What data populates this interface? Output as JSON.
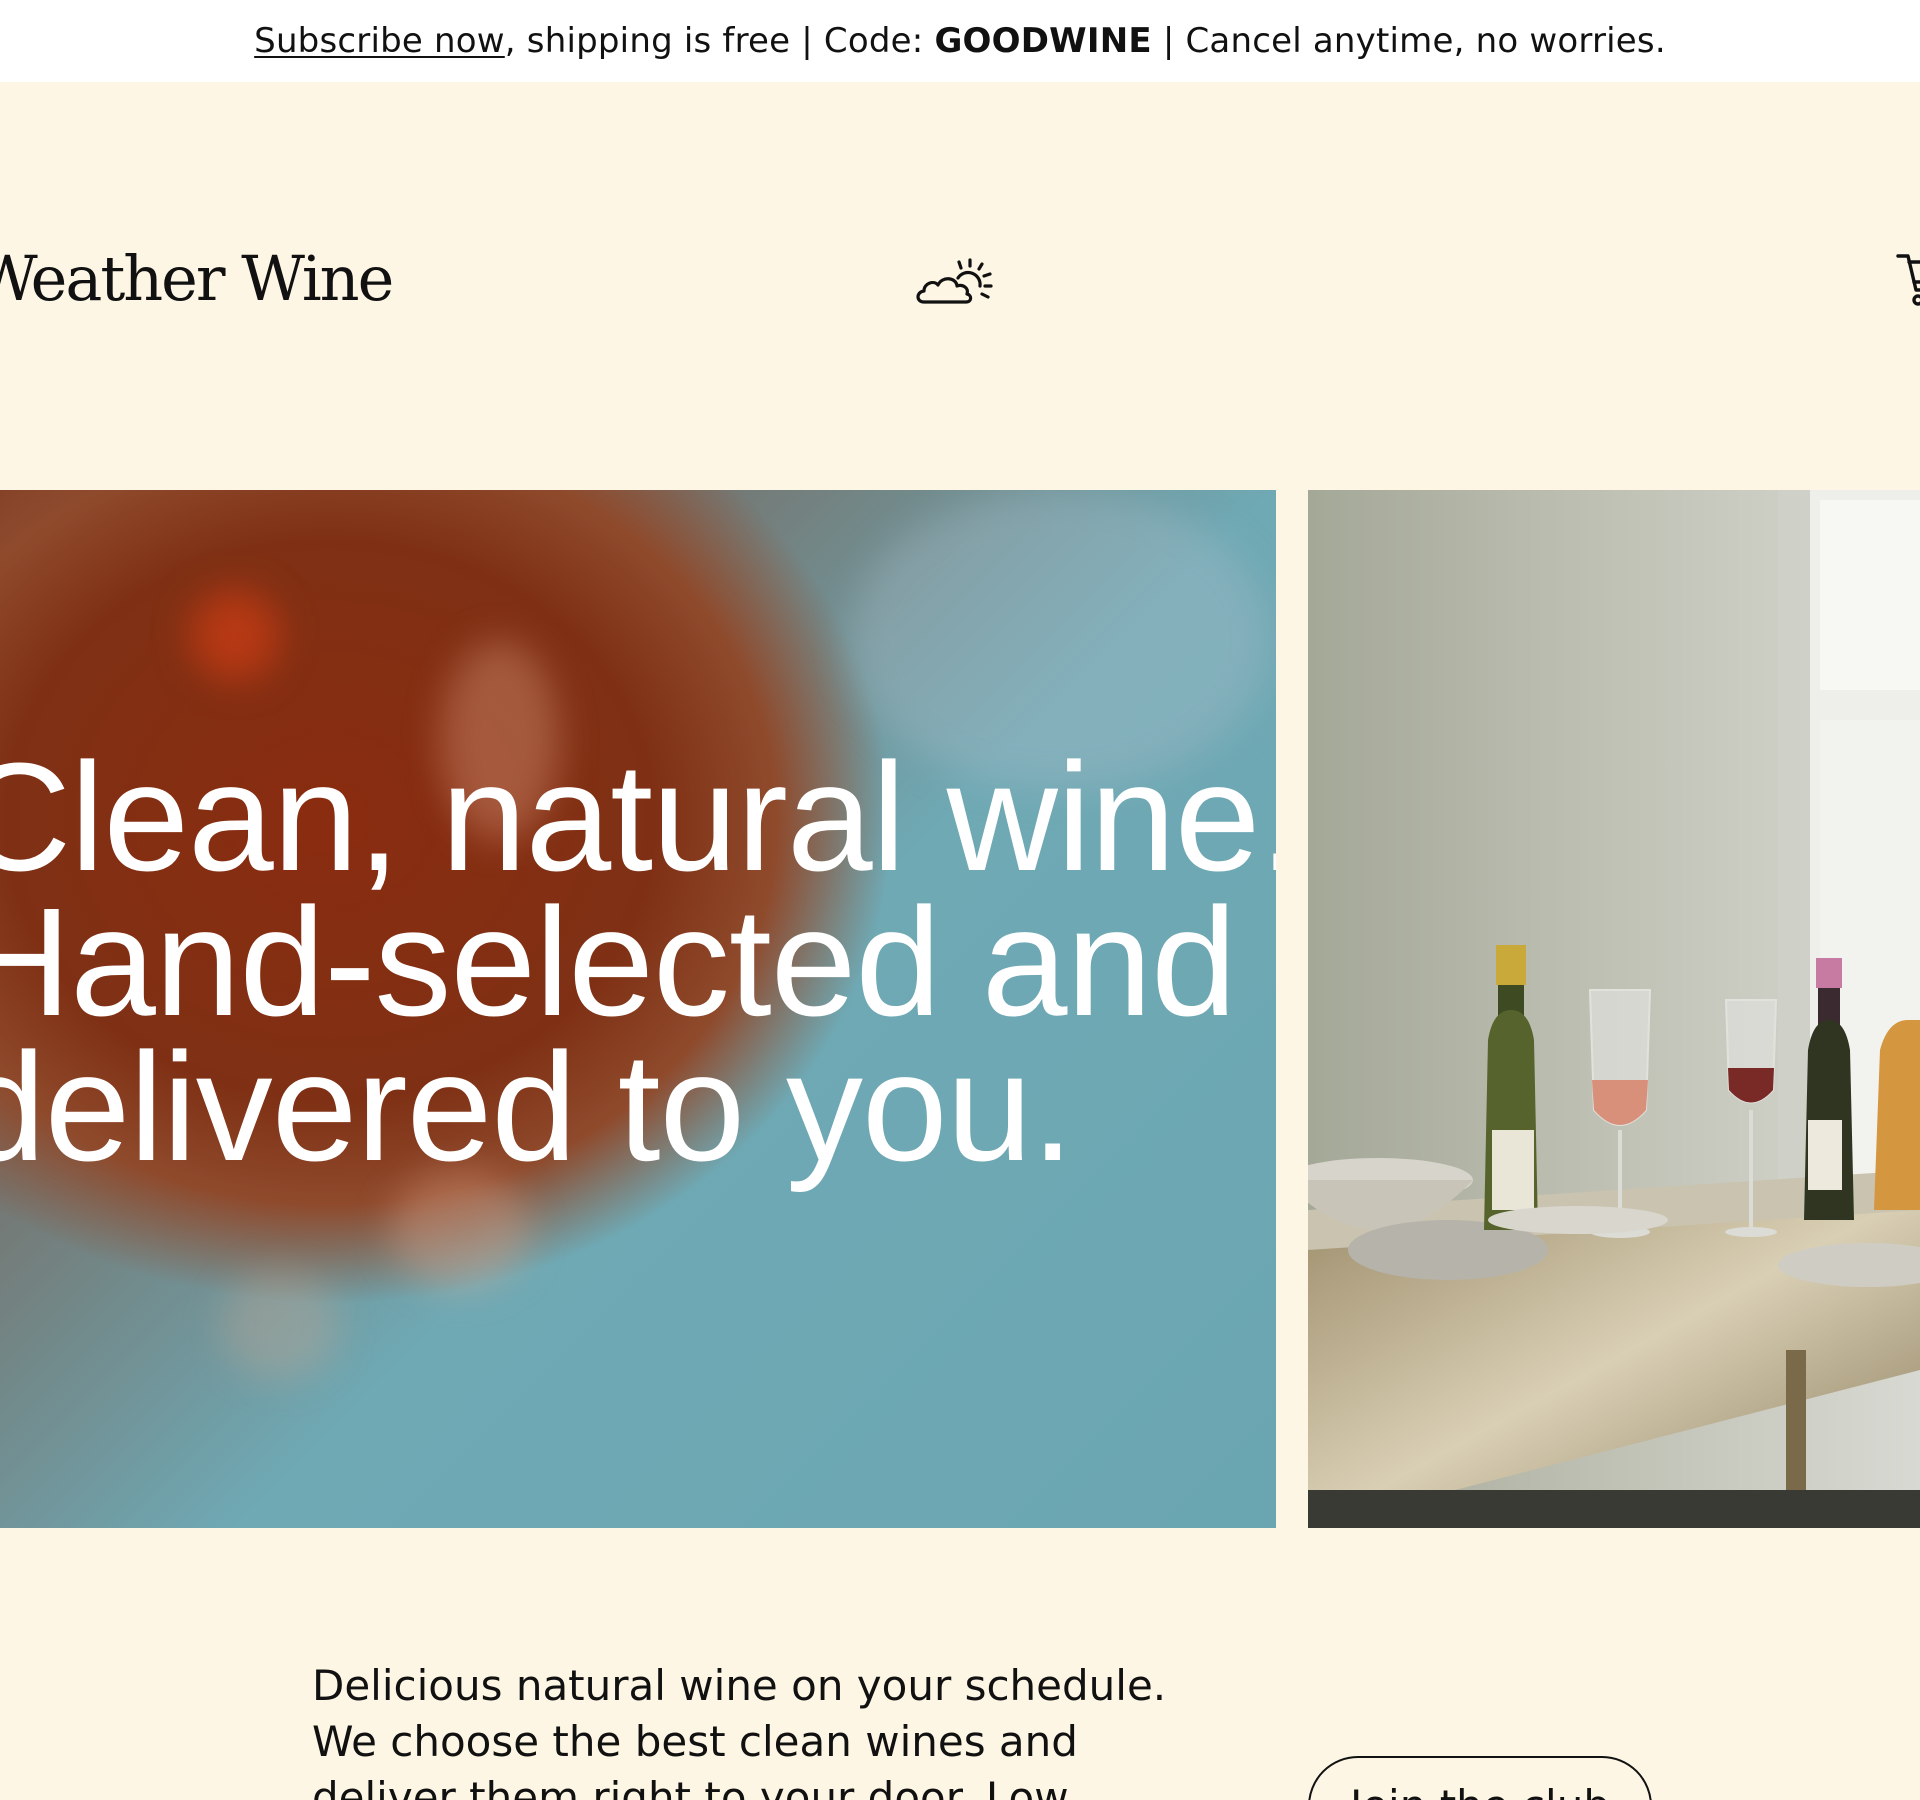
{
  "announcement": {
    "link_text": "Subscribe now",
    "middle_text": ", shipping is free | Code: ",
    "code": "GOODWINE",
    "end_text": " | Cancel anytime, no worries."
  },
  "header": {
    "logo_text": "Weather Wine",
    "center_icon": "cloud-sun-icon",
    "cart_icon": "cart-icon"
  },
  "hero": {
    "headline_lines": [
      "Clean, natural wine.",
      "Hand-selected and",
      "delivered to you."
    ],
    "left_image": "blurred wine glass against teal",
    "right_image": "wine bottles and glasses on table"
  },
  "intro": {
    "text": "Delicious natural wine on your schedule. We choose the best clean wines and deliver them right to your door. Low"
  },
  "cta": {
    "join_label": "Join the club"
  },
  "colors": {
    "background": "#fdf6e4",
    "announcement_bg": "#ffffff",
    "text": "#111111",
    "hero_teal": "#6aa6b2",
    "hero_rust": "#8a2c10"
  }
}
